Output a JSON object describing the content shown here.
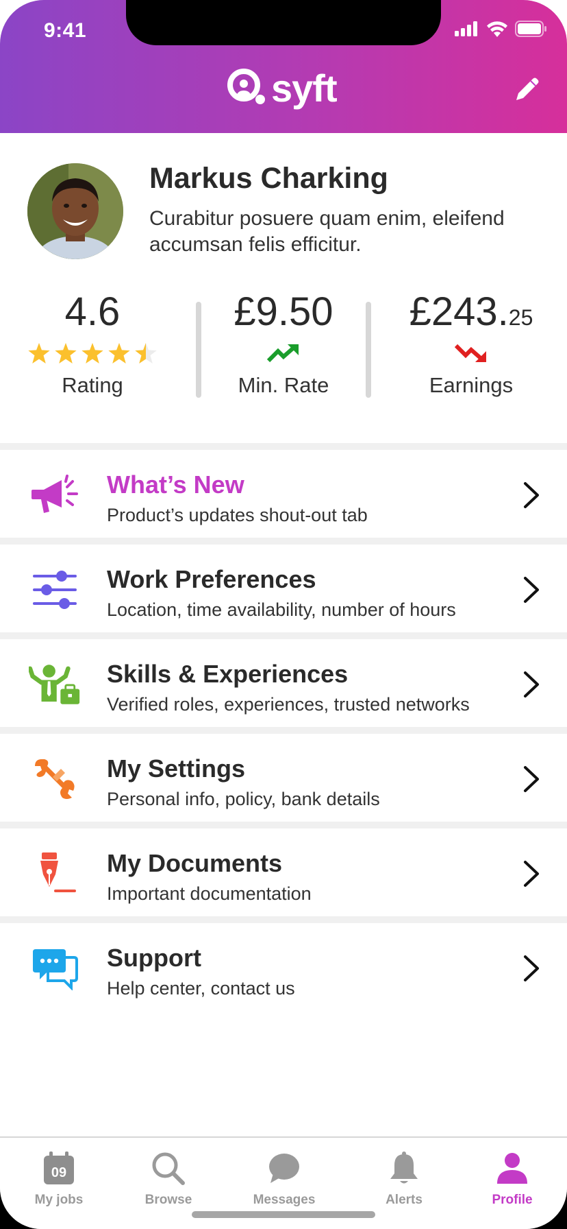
{
  "status_bar": {
    "time": "9:41"
  },
  "header": {
    "logo_text": "syft",
    "brand_gradient": [
      "#8b45c6",
      "#d62f9b"
    ]
  },
  "profile": {
    "name": "Markus Charking",
    "bio": "Curabitur posuere quam enim, eleifend accumsan felis efficitur."
  },
  "stats": {
    "rating": {
      "value": "4.6",
      "label": "Rating",
      "stars": 4.5,
      "max_stars": 5
    },
    "min_rate": {
      "value": "£9.50",
      "label": "Min. Rate",
      "trend": "up",
      "trend_color": "#1a9d2b"
    },
    "earnings": {
      "value": "£243.",
      "cents": "25",
      "label": "Earnings",
      "trend": "down",
      "trend_color": "#e02020"
    }
  },
  "menu": {
    "items": [
      {
        "title": "What’s New",
        "subtitle": "Product’s updates shout-out tab",
        "icon": "megaphone-icon",
        "color": "#c33bc6"
      },
      {
        "title": "Work Preferences",
        "subtitle": "Location, time availability, number of hours",
        "icon": "sliders-icon",
        "color": "#6a5ce6"
      },
      {
        "title": "Skills & Experiences",
        "subtitle": "Verified roles, experiences, trusted networks",
        "icon": "person-briefcase-icon",
        "color": "#6ab536"
      },
      {
        "title": "My Settings",
        "subtitle": "Personal info, policy, bank details",
        "icon": "wrench-icon",
        "color": "#f27a27"
      },
      {
        "title": "My Documents",
        "subtitle": "Important documentation",
        "icon": "fountain-pen-icon",
        "color": "#f0533f"
      },
      {
        "title": "Support",
        "subtitle": "Help center, contact us",
        "icon": "chat-bubbles-icon",
        "color": "#1da6ea"
      }
    ]
  },
  "tabbar": {
    "tabs": [
      {
        "label": "My jobs",
        "icon": "calendar-icon",
        "badge": "09",
        "active": false
      },
      {
        "label": "Browse",
        "icon": "search-icon",
        "active": false
      },
      {
        "label": "Messages",
        "icon": "chat-icon",
        "active": false
      },
      {
        "label": "Alerts",
        "icon": "bell-icon",
        "active": false
      },
      {
        "label": "Profile",
        "icon": "person-icon",
        "active": true
      }
    ],
    "active_color": "#c33bc6",
    "inactive_color": "#9a9a9a"
  }
}
